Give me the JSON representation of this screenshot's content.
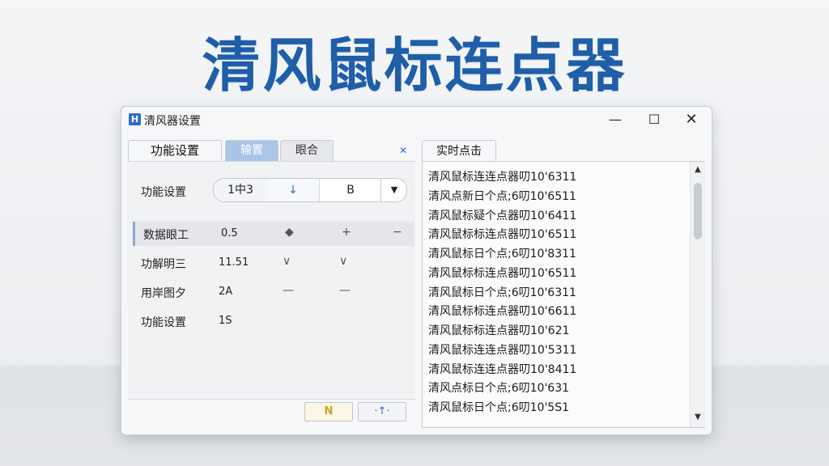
{
  "banner_title": "清风鼠标连点器",
  "window": {
    "title": "清风器设置",
    "controls": {
      "minimize": "—",
      "maximize": "☐",
      "close": "✕"
    }
  },
  "tabs": [
    {
      "label": "功能设置"
    },
    {
      "label": "输置"
    },
    {
      "label": "眼合"
    }
  ],
  "tab_close_glyph": "✕",
  "function_setting": {
    "label": "功能设置",
    "segments": [
      "1中3",
      "↓",
      "B"
    ],
    "dropdown_glyph": "▼"
  },
  "params": [
    {
      "label": "数据眼工",
      "value": "0.5",
      "i1": "◆",
      "i2": "+",
      "i3": "−"
    },
    {
      "label": "功解明三",
      "value": "11.51",
      "i1": "∨",
      "i2": "∨",
      "i3": ""
    },
    {
      "label": "用岸图夕",
      "value": "2A",
      "i1": "—",
      "i2": "—",
      "i3": ""
    },
    {
      "label": "功能设置",
      "value": "1S",
      "i1": "",
      "i2": "",
      "i3": ""
    }
  ],
  "bottom_buttons": [
    "N",
    "·↑·"
  ],
  "log": {
    "tab_label": "实时点击",
    "lines": [
      "清风鼠标连连点器叨10'6311",
      "清风点新日个点;6叨10'6511",
      "清风鼠标疑个点器叨10'6411",
      "清风鼠标标连点器叨10'6511",
      "清风鼠标日个点;6叨10'8311",
      "清风鼠标标连点器叨10'6511",
      "清风鼠标日个点;6叨10'6311",
      "清风鼠标标连点器叨10'6611",
      "清风鼠标标连点器叨10'621",
      "清风鼠标连连点器叨10'5311",
      "清风鼠标连连点器叨10'8411",
      "清风点标日个点;6叨10'631",
      "清风鼠标日个点;6叨10'5S1"
    ],
    "scroll_up": "▲",
    "scroll_down": "▼"
  }
}
